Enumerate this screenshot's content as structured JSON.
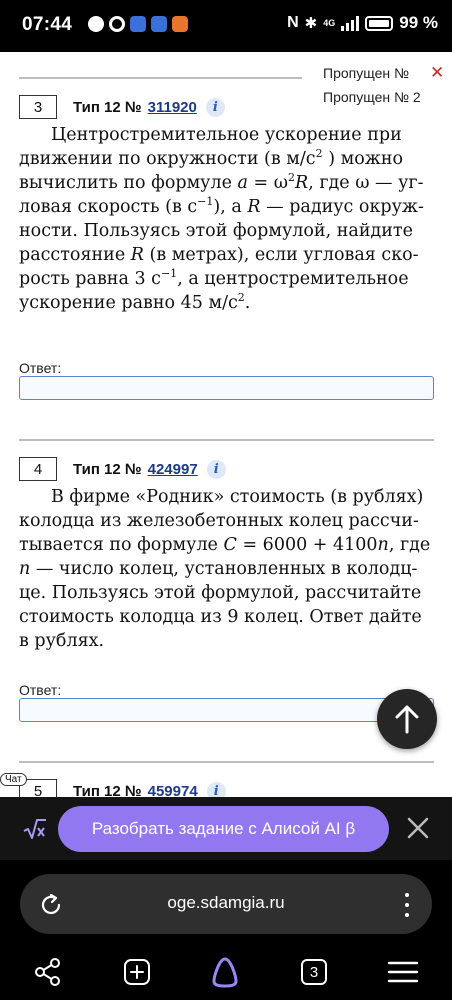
{
  "status": {
    "time": "07:44",
    "network": "4G",
    "battery": "99 %"
  },
  "sidebar": {
    "missed_1": "Пропущен №",
    "missed_2": "Пропущен № 2"
  },
  "tasks": [
    {
      "number": "3",
      "type_label": "Тип 12 №",
      "task_id": "311920",
      "text_lines": [
        "Центростремительное ускорение при",
        "движении по окружности (в м/с",
        "вычислить по формуле",
        "ловая скорость (в с",
        "ности. Пользуясь этой формулой, найдите",
        "расстояние",
        "рость равна 3 с",
        "ускорение равно 45 м/с"
      ],
      "t_after_sup_1": ") можно",
      "t_formula_a": "a",
      "t_formula_eq": " = ω",
      "t_formula_R": "R",
      "t_where": ", где ω — уг-",
      "t_after_sup_2": "), а",
      "t_R_var": "R",
      "t_radius": "— радиус окруж-",
      "t_metres": "(в метрах), если угловая ско-",
      "t_after_sup_3": ", а центростремительное",
      "t_end": ".",
      "sup_2": "2",
      "sup_m1": "−1",
      "answer_label": "Ответ:"
    },
    {
      "number": "4",
      "type_label": "Тип 12 №",
      "task_id": "424997",
      "text_lines": [
        "В фирме «Родник» стоимость (в рублях)",
        "колодца из железобетонных колец рассчи-",
        "тывается по формуле",
        "— число колец, установленных в колодц-",
        "це. Пользуясь этой формулой, рассчитайте",
        "стоимость колодца из 9 колец. Ответ дайте",
        "в рублях."
      ],
      "t_C": "C",
      "t_formula_rest": " = 6000 + 4100",
      "t_n": "n",
      "t_where": ", где",
      "answer_label": "Ответ:"
    },
    {
      "number": "5",
      "type_label": "Тип 12 №",
      "task_id": "459974"
    }
  ],
  "chat_badge": "Чат",
  "alice": {
    "label": "Разобрать задание с Алисой AI β"
  },
  "browser": {
    "url": "oge.sdamgia.ru",
    "tabs_count": "3"
  },
  "icons": {
    "close": "close-icon",
    "info": "info-icon",
    "scroll_up": "arrow-up-icon",
    "sqrt": "sqrt-icon",
    "reload": "reload-icon",
    "share": "share-icon",
    "new_tab": "plus-square-icon",
    "alice": "alice-icon",
    "menu": "hamburger-icon"
  },
  "colors": {
    "accent": "#9278f0",
    "link": "#1a3a8a",
    "input_border": "#5b86c9",
    "close": "#c62828"
  }
}
